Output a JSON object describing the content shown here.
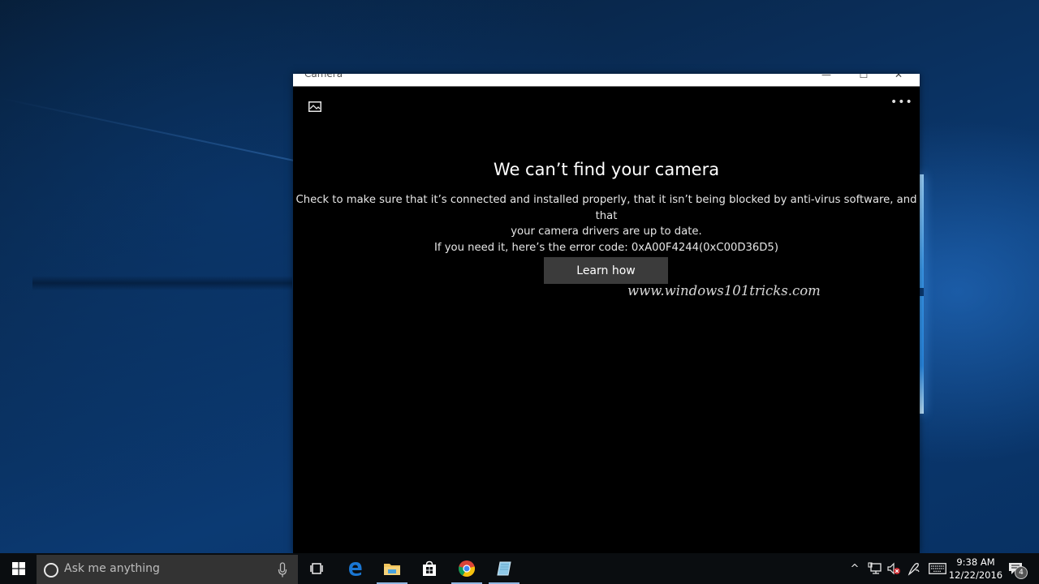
{
  "window": {
    "title": "Camera",
    "controls": {
      "minimize": "—",
      "maximize": "☐",
      "close": "✕"
    }
  },
  "app": {
    "top_left_icon": "photos-icon",
    "top_right_icon": "more-options-icon",
    "more_glyph": "•••",
    "headline": "We can’t find your camera",
    "message_line1": "Check to make sure that it’s connected and installed properly, that it isn’t being blocked by anti-virus software, and that",
    "message_line2": "your camera drivers are up to date.",
    "message_line3": "If you need it, here’s the error code: 0xA00F4244(0xC00D36D5)",
    "learn_button": "Learn how",
    "watermark": "www.windows101tricks.com"
  },
  "taskbar": {
    "search_placeholder": "Ask me anything",
    "pinned": [
      {
        "name": "task-view",
        "icon": "task-view-icon"
      },
      {
        "name": "edge",
        "icon": "edge-icon"
      },
      {
        "name": "file-explorer",
        "icon": "folder-icon"
      },
      {
        "name": "store",
        "icon": "store-icon"
      },
      {
        "name": "chrome",
        "icon": "chrome-icon"
      },
      {
        "name": "notepad",
        "icon": "notepad-icon"
      }
    ],
    "tray": {
      "chevron": "^",
      "time": "9:38 AM",
      "date": "12/22/2016",
      "notification_count": "4"
    }
  },
  "colors": {
    "window_bg": "#000000",
    "button_bg": "#3b3b3b",
    "taskbar_bg": "#0a0d10",
    "search_bg": "#333333",
    "desktop_accent": "#0b3a73"
  }
}
